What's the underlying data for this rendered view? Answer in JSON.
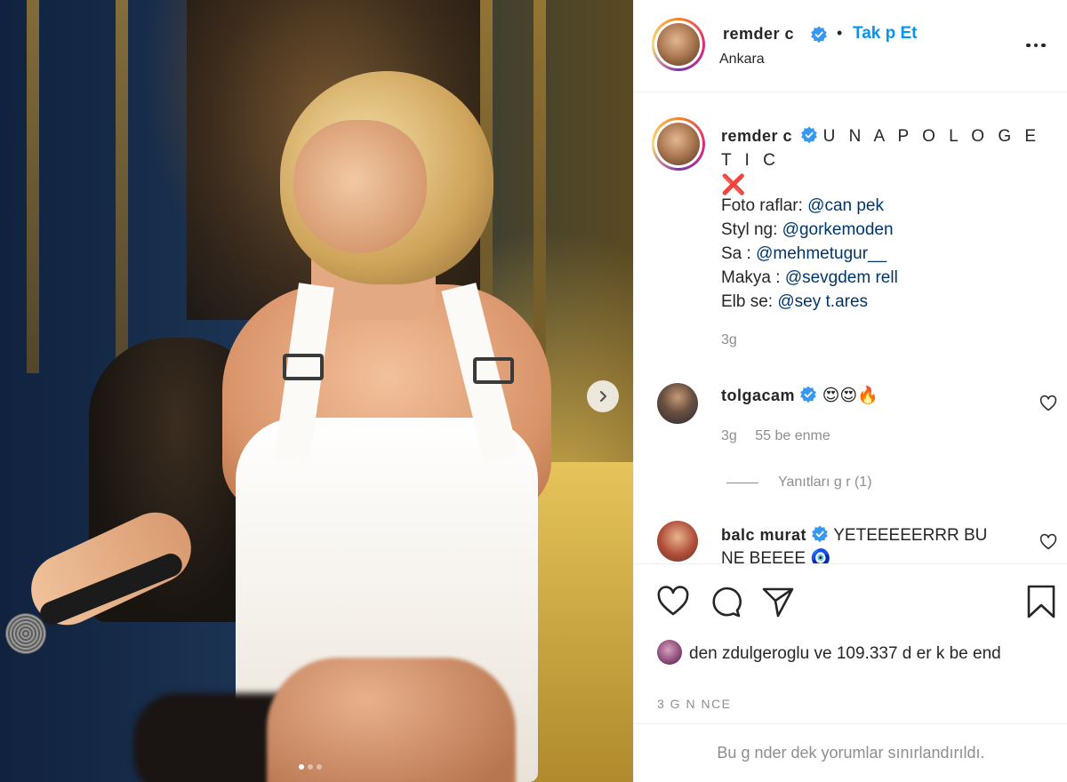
{
  "post": {
    "author": "remder c",
    "follow_label": "Tak p Et",
    "separator": "•",
    "location": "Ankara",
    "carousel": {
      "slide_count": 3,
      "active_index": 0
    }
  },
  "caption": {
    "author": "remder c",
    "title": "U N A P O L O G E T I C",
    "emoji": "❌",
    "credits": [
      {
        "label": "Foto   raflar: ",
        "mention": "@can pek"
      },
      {
        "label": "Styl ng: ",
        "mention": "@gorkemoden"
      },
      {
        "label": "Sa   : ",
        "mention": "@mehmetugur__"
      },
      {
        "label": "Makya : ",
        "mention": "@sevgdem rell"
      },
      {
        "label": "Elb se: ",
        "mention": "@sey t.ares"
      }
    ],
    "time": "3g"
  },
  "comments": [
    {
      "author": "tolgacam",
      "text": "😍😍🔥",
      "time": "3g",
      "likes": "55 be   enme",
      "replies_label": "Yanıtları g   r (1)"
    },
    {
      "author": "balc murat",
      "text": "YETEEEEERRR BU NE BEEEE 🧿"
    }
  ],
  "likes_summary": {
    "first_liker": "den zdulgeroglu",
    "rest": " ve 109.337 d    er k    be  end"
  },
  "date": "3 G   N   NCE",
  "footer": "Bu g   nder dek   yorumlar sınırlandırıldı.",
  "colors": {
    "link": "#0095f6",
    "mention": "#00376b",
    "muted": "#8e8e8e",
    "verified": "#3897f0"
  },
  "icons": [
    "verified-badge-icon",
    "more-options-icon",
    "heart-icon",
    "comment-icon",
    "share-icon",
    "bookmark-icon",
    "chevron-right-icon"
  ]
}
